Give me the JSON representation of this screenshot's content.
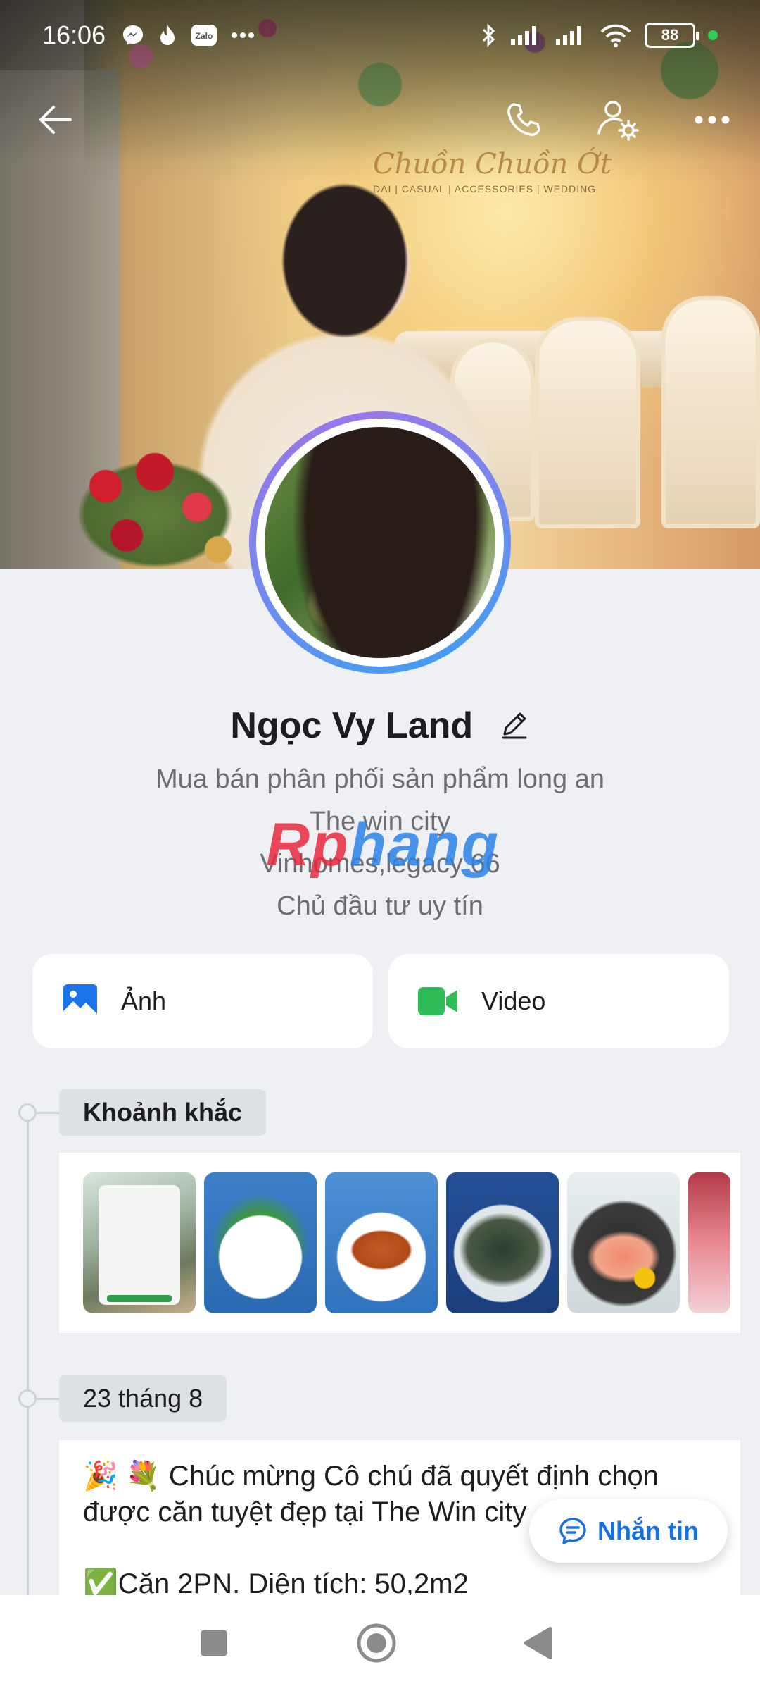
{
  "status_bar": {
    "time": "16:06",
    "left_icons": [
      "messenger-icon",
      "flame-icon",
      "zalo-icon",
      "more-dots-icon"
    ],
    "battery": "88",
    "right_icons": [
      "bluetooth-icon",
      "signal-icon",
      "signal-icon",
      "wifi-icon",
      "battery-icon",
      "active-dot"
    ]
  },
  "cover": {
    "sign_text": "Chuồn Chuồn Ớt",
    "sign_subtext": "DAI | CASUAL | ACCESSORIES | WEDDING"
  },
  "top_nav": {
    "back_icon": "back-arrow-icon",
    "call_icon": "phone-icon",
    "settings_icon": "user-settings-icon",
    "more_icon": "more-horizontal-icon"
  },
  "profile": {
    "name": "Ngọc Vy Land",
    "bio": [
      "Mua bán phân phối sản phẩm long an",
      "The win city",
      "Vinhomes,legacy 66",
      "Chủ đầu tư uy tín"
    ],
    "watermark_a": "Rp",
    "watermark_b": "hang"
  },
  "actions": {
    "photos_label": "Ảnh",
    "video_label": "Video"
  },
  "timeline": {
    "moments_label": "Khoảnh khắc",
    "date_label": "23 tháng 8",
    "post_lines": [
      "🎉 💐 Chúc mừng Cô chú đã quyết định chọn",
      "được căn tuyệt đẹp tại The Win city",
      "",
      "✅Căn 2PN. Diện tích: 50,2m2"
    ]
  },
  "message_button": {
    "label": "Nhắn tin"
  },
  "colors": {
    "accent": "#1a6fe0",
    "photo_icon": "#1a73e8",
    "video_icon": "#2fbd5a",
    "background": "#eef0f3"
  }
}
